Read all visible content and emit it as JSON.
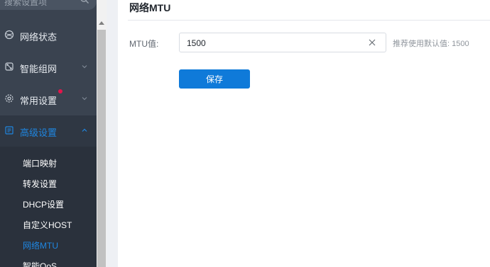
{
  "sidebar": {
    "search": {
      "placeholder": "搜索设置项"
    },
    "items": [
      {
        "label": "网络状态",
        "icon": "globe-icon",
        "active": false
      },
      {
        "label": "智能组网",
        "icon": "mesh-network-icon",
        "active": false,
        "expandable": true
      },
      {
        "label": "常用设置",
        "icon": "gear-icon",
        "active": false,
        "expandable": true,
        "badge": "red-dot"
      },
      {
        "label": "高级设置",
        "icon": "advanced-settings-icon",
        "active": true,
        "expanded": true
      }
    ],
    "submenu": [
      {
        "label": "端口映射",
        "active": false
      },
      {
        "label": "转发设置",
        "active": false
      },
      {
        "label": "DHCP设置",
        "active": false
      },
      {
        "label": "自定义HOST",
        "active": false
      },
      {
        "label": "网络MTU",
        "active": true
      },
      {
        "label": "智能QoS",
        "active": false
      }
    ]
  },
  "main": {
    "title": "网络MTU",
    "mtu": {
      "label": "MTU值:",
      "value": "1500",
      "hint": "推荐使用默认值: 1500"
    },
    "save_label": "保存"
  },
  "colors": {
    "sidebar_bg": "#3a4350",
    "submenu_bg": "#2a313c",
    "accent": "#1f86e0",
    "button": "#0f7ad9",
    "badge": "#e3154b"
  }
}
